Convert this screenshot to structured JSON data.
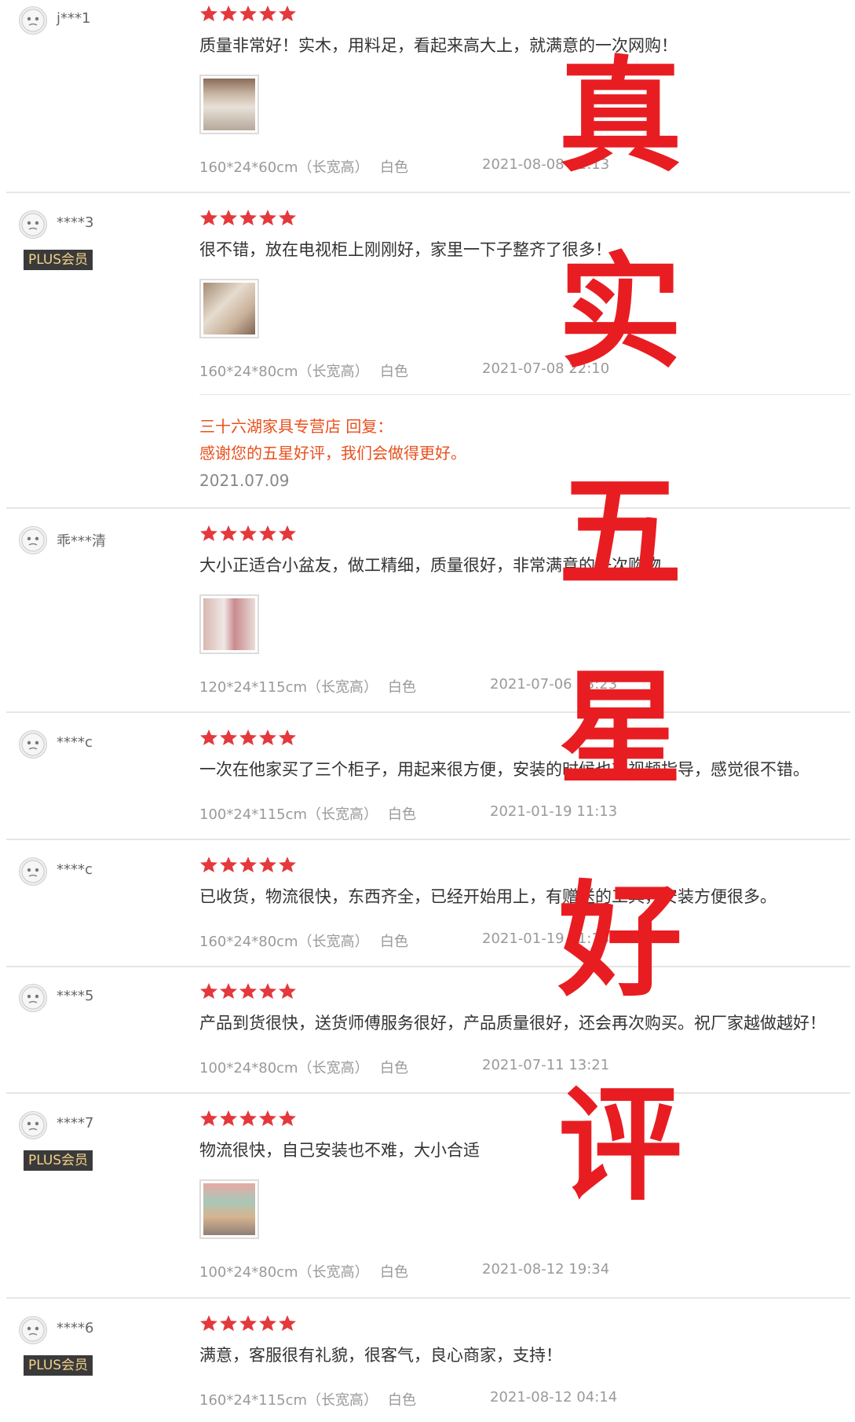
{
  "reviews": [
    {
      "user": "j***1",
      "text": "质量非常好！实木，用料足，看起来高大上，就满意的一次网购！",
      "size": "160*24*60cm（长宽高）",
      "color": "白色",
      "date": "2021-08-08 11:13"
    },
    {
      "user": "****3",
      "plus": "PLUS会员",
      "text": "很不错，放在电视柜上刚刚好，家里一下子整齐了很多！",
      "size": "160*24*80cm（长宽高）",
      "color": "白色",
      "date": "2021-07-08 22:10",
      "reply": {
        "title": "三十六湖家具专营店 回复：",
        "body": "感谢您的五星好评，我们会做得更好。",
        "date": "2021.07.09"
      }
    },
    {
      "user": "乖***清",
      "text": "大小正适合小盆友，做工精细，质量很好，非常满意的一次购物",
      "size": "120*24*115cm（长宽高）",
      "color": "白色",
      "date": "2021-07-06 13:23"
    },
    {
      "user": "****c",
      "text": "一次在他家买了三个柜子，用起来很方便，安装的时候也有视频指导，感觉很不错。",
      "size": "100*24*115cm（长宽高）",
      "color": "白色",
      "date": "2021-01-19 11:13"
    },
    {
      "user": "****c",
      "text": "已收货，物流很快，东西齐全，已经开始用上，有赠送的工具，安装方便很多。",
      "size": "160*24*80cm（长宽高）",
      "color": "白色",
      "date": "2021-01-19 11:13"
    },
    {
      "user": "****5",
      "text": "产品到货很快，送货师傅服务很好，产品质量很好，还会再次购买。祝厂家越做越好！",
      "size": "100*24*80cm（长宽高）",
      "color": "白色",
      "date": "2021-07-11 13:21"
    },
    {
      "user": "****7",
      "plus": "PLUS会员",
      "text": "物流很快，自己安装也不难，大小合适",
      "size": "100*24*80cm（长宽高）",
      "color": "白色",
      "date": "2021-08-12 19:34"
    },
    {
      "user": "****6",
      "plus": "PLUS会员",
      "text": "满意，客服很有礼貌，很客气，良心商家，支持！",
      "size": "160*24*115cm（长宽高）",
      "color": "白色",
      "date": "2021-08-12 04:14"
    }
  ],
  "overlay": {
    "chars": [
      "真",
      "实",
      "五",
      "星",
      "好",
      "评"
    ],
    "color": "#e81d22"
  },
  "colors": {
    "star": "#e4393c",
    "reply": "#e8501e",
    "plus_bg": "#3a3a3a",
    "plus_fg": "#f3d18a"
  },
  "icons": {
    "star": "star-icon",
    "avatar": "avatar-icon"
  }
}
